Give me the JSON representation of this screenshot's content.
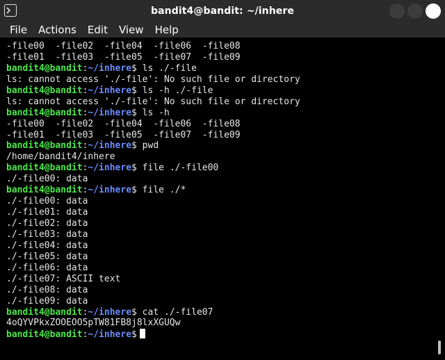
{
  "window": {
    "title": "bandit4@bandit: ~/inhere"
  },
  "menu": {
    "items": [
      "File",
      "Actions",
      "Edit",
      "View",
      "Help"
    ]
  },
  "colors": {
    "prompt_user": "#4ce64c",
    "prompt_path": "#6b8cff",
    "text": "#e6e6e6",
    "background": "#000000",
    "titlebar": "#2b2b2b"
  },
  "prompt": {
    "user": "bandit4@bandit",
    "colon": ":",
    "path": "~/inhere",
    "dollar": "$"
  },
  "terminal_lines": [
    {
      "type": "out",
      "text": "-file00  -file02  -file04  -file06  -file08"
    },
    {
      "type": "out",
      "text": "-file01  -file03  -file05  -file07  -file09"
    },
    {
      "type": "cmd",
      "text": " ls ./-file"
    },
    {
      "type": "out",
      "text": "ls: cannot access './-file': No such file or directory"
    },
    {
      "type": "cmd",
      "text": " ls -h ./-file"
    },
    {
      "type": "out",
      "text": "ls: cannot access './-file': No such file or directory"
    },
    {
      "type": "cmd",
      "text": " ls -h"
    },
    {
      "type": "out",
      "text": "-file00  -file02  -file04  -file06  -file08"
    },
    {
      "type": "out",
      "text": "-file01  -file03  -file05  -file07  -file09"
    },
    {
      "type": "cmd",
      "text": " pwd"
    },
    {
      "type": "out",
      "text": "/home/bandit4/inhere"
    },
    {
      "type": "cmd",
      "text": " file ./-file00"
    },
    {
      "type": "out",
      "text": "./-file00: data"
    },
    {
      "type": "cmd",
      "text": " file ./*"
    },
    {
      "type": "out",
      "text": "./-file00: data"
    },
    {
      "type": "out",
      "text": "./-file01: data"
    },
    {
      "type": "out",
      "text": "./-file02: data"
    },
    {
      "type": "out",
      "text": "./-file03: data"
    },
    {
      "type": "out",
      "text": "./-file04: data"
    },
    {
      "type": "out",
      "text": "./-file05: data"
    },
    {
      "type": "out",
      "text": "./-file06: data"
    },
    {
      "type": "out",
      "text": "./-file07: ASCII text"
    },
    {
      "type": "out",
      "text": "./-file08: data"
    },
    {
      "type": "out",
      "text": "./-file09: data"
    },
    {
      "type": "cmd",
      "text": " cat ./-file07"
    },
    {
      "type": "out",
      "text": "4oQYVPkxZOOEOO5pTW81FB8j8lxXGUQw"
    },
    {
      "type": "current",
      "text": ""
    }
  ],
  "icons": {
    "app": "terminal-icon",
    "minimize": "minimize-icon",
    "maximize": "maximize-icon",
    "close": "close-icon"
  }
}
